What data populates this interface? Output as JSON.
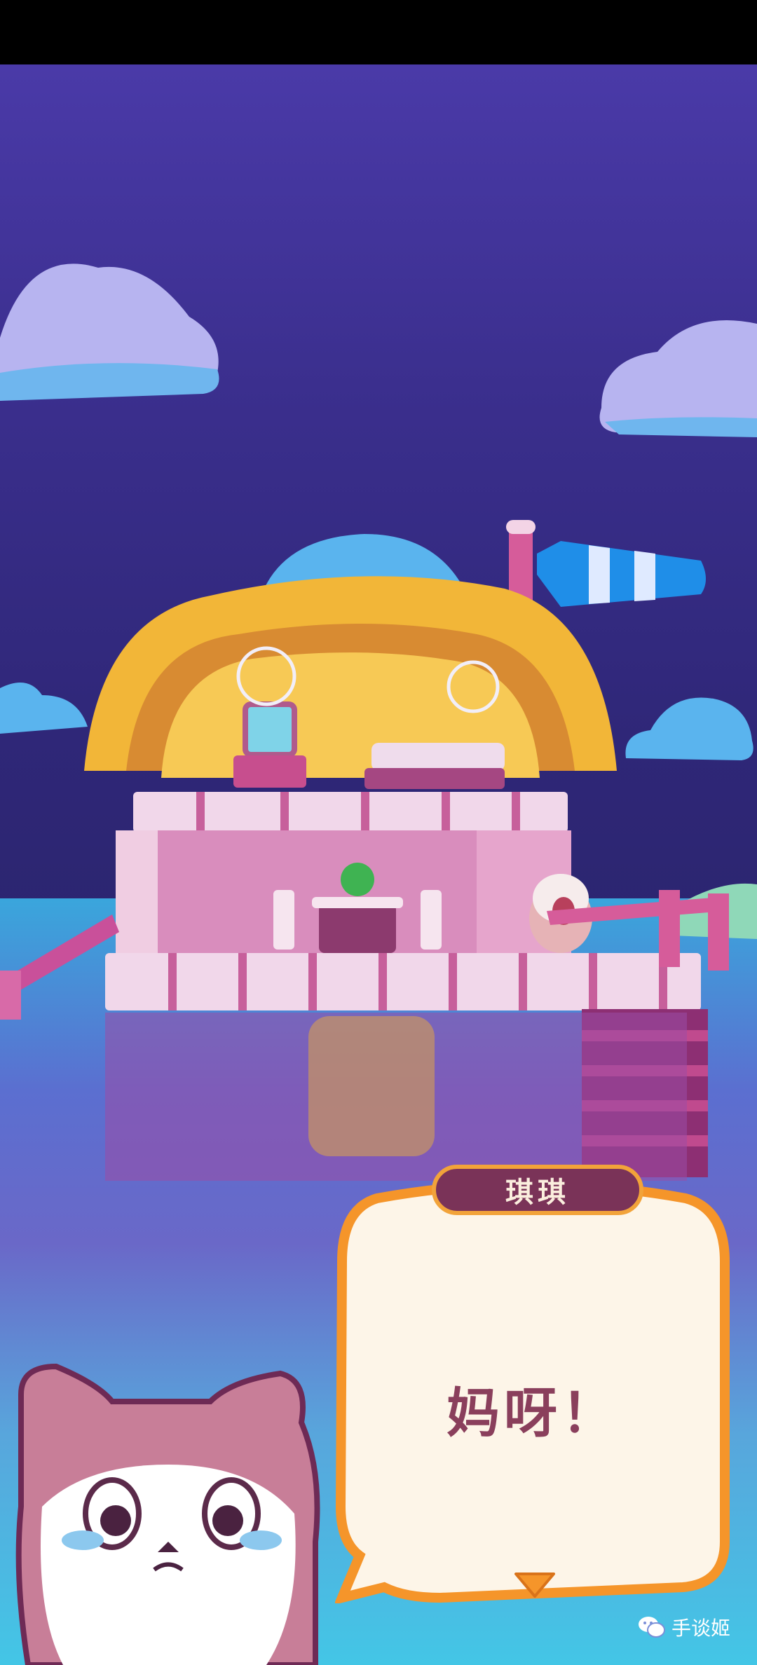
{
  "dialog": {
    "speaker": "琪琪",
    "text": "妈呀！"
  },
  "watermark": {
    "label": "手谈姬"
  },
  "icons": {
    "continue": "chevron-down-icon",
    "wechat": "wechat-icon"
  },
  "colors": {
    "sky_top": "#4a3aa8",
    "sky_bottom": "#2a246c",
    "sea": "#43c6e6",
    "bubble_fill": "#fdf5e8",
    "bubble_border": "#f5952a",
    "speaker_tag": "#7a3358",
    "dialog_text": "#8a3f5c"
  }
}
